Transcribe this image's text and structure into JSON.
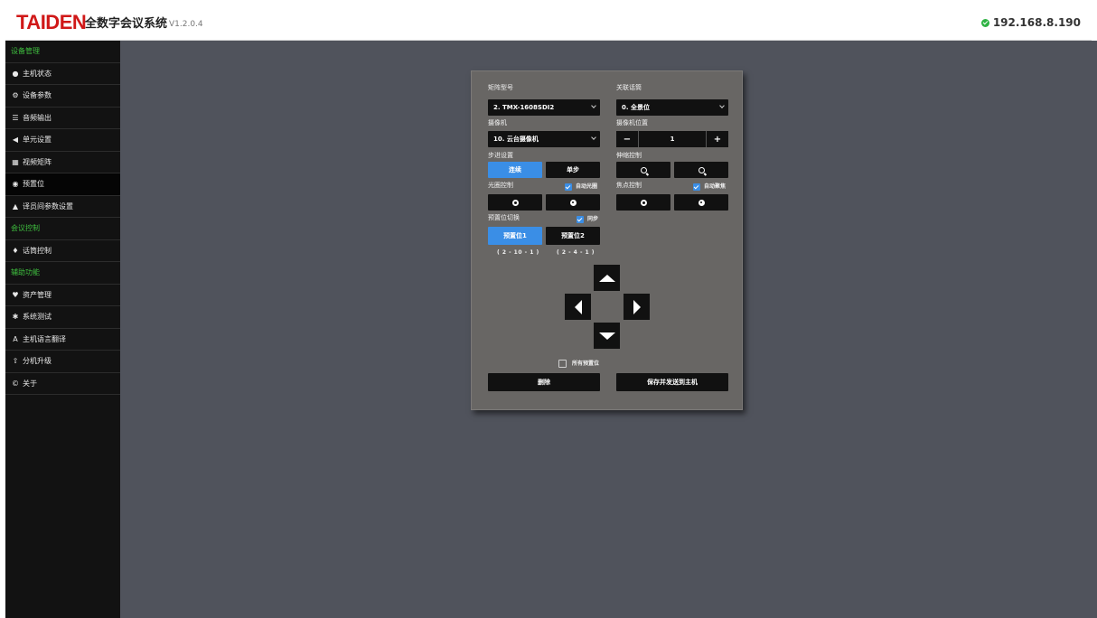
{
  "header": {
    "brand": "TAIDEN",
    "system_name": "全数字会议系统",
    "version": "V1.2.0.4",
    "ip_address": "192.168.8.190",
    "status_color": "#2fb344"
  },
  "sidebar": {
    "items": [
      {
        "label": "设备管理",
        "type": "section",
        "icon": ""
      },
      {
        "label": "主机状态",
        "type": "item",
        "icon": "info-icon"
      },
      {
        "label": "设备参数",
        "type": "item",
        "icon": "gears-icon"
      },
      {
        "label": "音频输出",
        "type": "item",
        "icon": "sliders-icon"
      },
      {
        "label": "单元设置",
        "type": "item",
        "icon": "speaker-icon"
      },
      {
        "label": "视频矩阵",
        "type": "item",
        "icon": "grid-icon"
      },
      {
        "label": "预置位",
        "type": "item",
        "icon": "camera-icon",
        "active": true
      },
      {
        "label": "译员间参数设置",
        "type": "item",
        "icon": "bank-icon"
      },
      {
        "label": "会议控制",
        "type": "section",
        "icon": ""
      },
      {
        "label": "话筒控制",
        "type": "item",
        "icon": "microphone-icon"
      },
      {
        "label": "辅助功能",
        "type": "section",
        "icon": ""
      },
      {
        "label": "资产管理",
        "type": "item",
        "icon": "map-pin-icon"
      },
      {
        "label": "系统测试",
        "type": "item",
        "icon": "bug-icon"
      },
      {
        "label": "主机语言翻译",
        "type": "item",
        "icon": "font-icon"
      },
      {
        "label": "分机升级",
        "type": "item",
        "icon": "upload-icon"
      },
      {
        "label": "关于",
        "type": "item",
        "icon": "copyright-icon"
      }
    ]
  },
  "panel": {
    "matrix_type_label": "矩阵型号",
    "matrix_type_value": "2. TMX-1608SDI2",
    "linked_mic_label": "关联话筒",
    "linked_mic_value": "0. 全景位",
    "camera_label": "摄像机",
    "camera_value": "10. 云台摄像机",
    "camera_pos_label": "摄像机位置",
    "camera_pos_value": "1",
    "camera_pos_minus": "−",
    "camera_pos_plus": "+",
    "step_label": "步进设置",
    "step_continuous": "连续",
    "step_single": "单步",
    "zoom_label": "伸缩控制",
    "aperture_label": "光圈控制",
    "aperture_auto_label": "自动光圈",
    "aperture_auto_checked": true,
    "focus_label": "焦点控制",
    "focus_auto_label": "自动聚焦",
    "focus_auto_checked": true,
    "preset_switch_label": "预置位切换",
    "sync_label": "同步",
    "sync_checked": true,
    "preset1_label": "预置位1",
    "preset1_sub": "( 2 - 10 - 1 )",
    "preset2_label": "预置位2",
    "preset2_sub": "( 2 - 4 - 1 )",
    "all_presets_label": "所有预置位",
    "all_presets_checked": false,
    "delete_label": "删除",
    "save_label": "保存并发送到主机",
    "accent_color": "#3a8ee6"
  }
}
